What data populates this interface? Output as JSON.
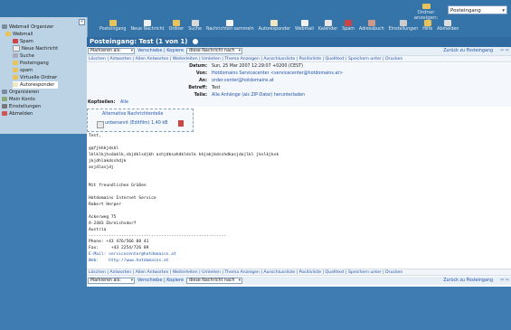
{
  "header": {
    "folder_label": "Ordner anzeigen:",
    "folder_selected": "Posteingang",
    "toolbar": [
      {
        "label": "Posteingang",
        "icon": "inbox-icon",
        "color": "#e8c25a"
      },
      {
        "label": "Neue Nachricht",
        "icon": "new-message-icon",
        "color": "#f0f0f0"
      },
      {
        "label": "Ordner",
        "icon": "folder-icon",
        "color": "#e8c25a"
      },
      {
        "label": "Suche",
        "icon": "search-icon",
        "color": "#d9d9d9"
      },
      {
        "label": "Nachrichten sammeln",
        "icon": "fetch-mail-icon",
        "color": "#f2f2f2"
      },
      {
        "label": "Autoresponder",
        "icon": "autoresponder-icon",
        "color": "#f0e6c0"
      },
      {
        "label": "Webmail",
        "icon": "webmail-icon",
        "color": "#f0f0f0"
      },
      {
        "label": "Kalender",
        "icon": "calendar-icon",
        "color": "#e6e6e6"
      },
      {
        "label": "Spam",
        "icon": "spam-icon",
        "color": "#c44"
      },
      {
        "label": "Adressbuch",
        "icon": "addressbook-icon",
        "color": "#c98"
      },
      {
        "label": "Einstellungen",
        "icon": "settings-icon",
        "color": "#ccc"
      },
      {
        "label": "Hilfe",
        "icon": "help-icon",
        "color": "#e8c25a"
      },
      {
        "label": "Abmelden",
        "icon": "logout-icon",
        "color": "#ddd"
      }
    ]
  },
  "sidebar": {
    "collapse": "«",
    "items": [
      {
        "label": "Webmail Organizer",
        "icon": "organizer-icon",
        "color": "#7a8ca0"
      },
      {
        "label": "Webmail",
        "icon": "webmail-icon",
        "color": "#e8c25a"
      },
      {
        "label": "Spam",
        "icon": "spam-icon",
        "color": "#c44"
      },
      {
        "label": "Neue Nachricht",
        "icon": "new-message-icon",
        "color": "#eee"
      },
      {
        "label": "Suche",
        "icon": "search-icon",
        "color": "#aab"
      },
      {
        "label": "Posteingang",
        "icon": "inbox-icon",
        "color": "#e8c25a"
      },
      {
        "label": "spam",
        "icon": "folder-icon",
        "color": "#e8c25a"
      },
      {
        "label": "Virtuelle Ordner",
        "icon": "virtual-folder-icon",
        "color": "#e8c25a"
      },
      {
        "label": "Autoresponder",
        "icon": "autoresponder-icon",
        "color": "#f0e6c0"
      },
      {
        "label": "Organisieren",
        "icon": "organize-icon",
        "color": "#7a8ca0"
      },
      {
        "label": "Mein Konto",
        "icon": "account-icon",
        "color": "#8a7"
      },
      {
        "label": "Einstellungen",
        "icon": "settings-icon",
        "color": "#777"
      },
      {
        "label": "Abmelden",
        "icon": "logout-icon",
        "color": "#c55"
      }
    ]
  },
  "main": {
    "title": "Posteingang: Test (1 von 1)",
    "mark_select": "Markieren als:",
    "move_link": "Verschiebe | Kopiere",
    "move_select": "diese Nachricht nach",
    "back_link": "Zurück zu Posteingang",
    "actions": "Löschen | Antworten | Allen Antworten | Weiterleiten | Umleiten | Thema Anzeigen | Ausschlussliste | Positivliste | Quelltext | Speichern unter | Drucken",
    "headers": {
      "date_label": "Datum:",
      "date_value": "Sun, 25 Mar 2007 12:29:07 +0200 (CEST)",
      "from_label": "Von:",
      "from_value": "Hotdomains Servicecenter <servicecenter@hotdomains.at>",
      "to_label": "An:",
      "to_value": "order.center@hotdomains.at",
      "subject_label": "Betreff:",
      "subject_value": "Test",
      "parts_label": "Teile:",
      "parts_value": "Alle Anhänge (als ZIP-Datei) herunterladen",
      "headers_label": "Kopfzeilen:",
      "headers_value": "Alle"
    },
    "attachment": {
      "title": "Alternative Nachrichtenteile",
      "file": "unbenannt (Editfilm) 1,40 kB"
    },
    "body": [
      "Test,",
      "",
      "gqfjkhkjdskl",
      "lklklkjhsdaklk,sbjdklsdjkh ashjdksahdkldslk khjakjkdsshdkasjdojlkl jkslkjksk",
      "jkjdhlakdsshdjk",
      "asjdlasjdj",
      "",
      "",
      "Mit freundlichen Grüßen",
      "",
      "Hotdomains Internet Service",
      "Robert Herper",
      "",
      "Ackerweg 75",
      "A-2483 Ebreichsdorf",
      "Austria",
      "-------------------------------------------------------",
      "Phone: +43 476/566 08 41",
      "Fax:     +43 2254/726 89",
      "E-Mail: servicecenter@hotdomains.at",
      "Web:    http://www.hotdomains.at"
    ]
  }
}
